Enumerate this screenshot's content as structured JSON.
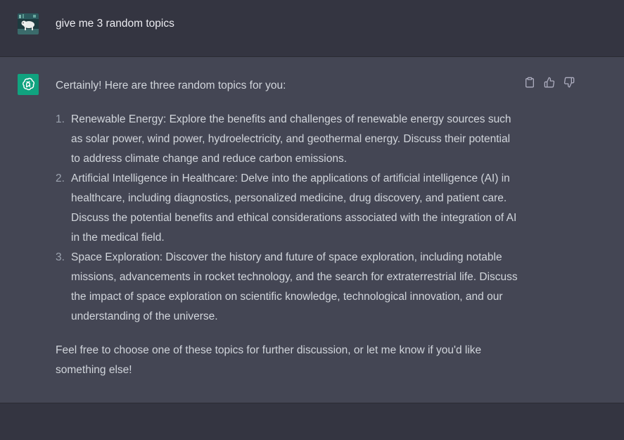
{
  "user_message": {
    "text": "give me 3 random topics"
  },
  "assistant_message": {
    "intro": "Certainly! Here are three random topics for you:",
    "items": [
      {
        "number": "1.",
        "text": "Renewable Energy: Explore the benefits and challenges of renewable energy sources such as solar power, wind power, hydroelectricity, and geothermal energy. Discuss their potential to address climate change and reduce carbon emissions."
      },
      {
        "number": "2.",
        "text": "Artificial Intelligence in Healthcare: Delve into the applications of artificial intelligence (AI) in healthcare, including diagnostics, personalized medicine, drug discovery, and patient care. Discuss the potential benefits and ethical considerations associated with the integration of AI in the medical field."
      },
      {
        "number": "3.",
        "text": "Space Exploration: Discover the history and future of space exploration, including notable missions, advancements in rocket technology, and the search for extraterrestrial life. Discuss the impact of space exploration on scientific knowledge, technological innovation, and our understanding of the universe."
      }
    ],
    "outro": "Feel free to choose one of these topics for further discussion, or let me know if you'd like something else!"
  },
  "actions": {
    "copy_icon": "clipboard-icon",
    "like_icon": "thumbs-up-icon",
    "dislike_icon": "thumbs-down-icon"
  },
  "colors": {
    "background": "#343541",
    "assistant_background": "#444654",
    "assistant_avatar": "#10a37f",
    "text": "#d1d5db"
  }
}
